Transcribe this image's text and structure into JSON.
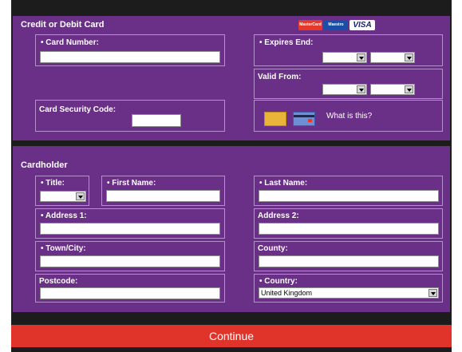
{
  "card_section": {
    "title": "Credit or Debit Card",
    "card_logos": [
      "MasterCard",
      "Maestro",
      "VISA"
    ],
    "card_number_label": "• Card Number:",
    "card_number_value": "",
    "expires_end_label": "• Expires End:",
    "expires_month": "",
    "expires_year": "",
    "valid_from_label": "Valid From:",
    "valid_from_month": "",
    "valid_from_year": "",
    "security_code_label": "Card Security Code:",
    "security_code_value": "",
    "what_is_this": "What is this?"
  },
  "cardholder_section": {
    "title": "Cardholder",
    "title_label": "• Title:",
    "title_value": "",
    "first_name_label": "• First Name:",
    "last_name_label": "• Last Name:",
    "address1_label": "• Address 1:",
    "address2_label": "Address 2:",
    "town_label": "• Town/City:",
    "county_label": "County:",
    "postcode_label": "Postcode:",
    "country_label": "• Country:",
    "country_value": "United Kingdom"
  },
  "continue_label": "Continue",
  "colors": {
    "panel": "#6a2f86",
    "border": "#b68fcf",
    "button": "#e0332a",
    "frame": "#1c1c1c"
  }
}
